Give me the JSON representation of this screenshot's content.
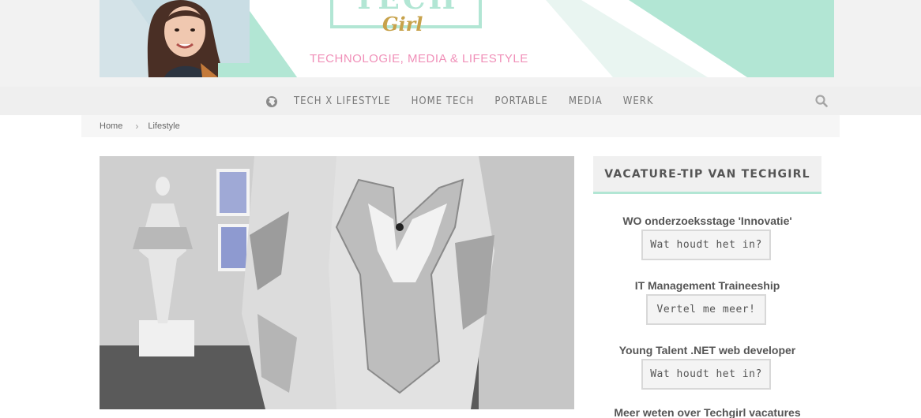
{
  "header": {
    "logo_top": "TECH",
    "logo_sub": "Girl",
    "tagline": "TECHNOLOGIE, MEDIA & LIFESTYLE",
    "colors": {
      "mint": "#b2e6d4",
      "pink": "#f08fb8",
      "gold": "#c7a24b"
    }
  },
  "nav": {
    "items": [
      {
        "label": "TECH X LIFESTYLE"
      },
      {
        "label": "HOME TECH"
      },
      {
        "label": "PORTABLE"
      },
      {
        "label": "MEDIA"
      },
      {
        "label": "WERK"
      }
    ],
    "icons": {
      "left": "globe-icon",
      "right": "search-icon"
    }
  },
  "breadcrumb": {
    "home": "Home",
    "current": "Lifestyle"
  },
  "sidebar": {
    "widget_title": "VACATURE-TIP VAN TECHGIRL",
    "jobs": [
      {
        "title": "WO onderzoeksstage 'Innovatie'",
        "button": "Wat houdt het in?"
      },
      {
        "title": "IT Management Traineeship",
        "button": "Vertel me meer!"
      },
      {
        "title": "Young Talent .NET web developer",
        "button": "Wat houdt het in?"
      }
    ],
    "more_link": "Meer weten over Techgirl vacatures"
  }
}
